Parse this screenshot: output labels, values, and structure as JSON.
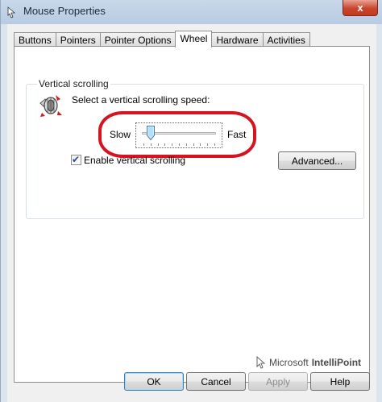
{
  "window": {
    "title": "Mouse Properties",
    "close_label": "x"
  },
  "tabs": [
    {
      "label": "Buttons"
    },
    {
      "label": "Pointers"
    },
    {
      "label": "Pointer Options"
    },
    {
      "label": "Wheel",
      "active": true
    },
    {
      "label": "Hardware"
    },
    {
      "label": "Activities"
    }
  ],
  "vertical_scrolling": {
    "group_label": "Vertical scrolling",
    "speed_prompt": "Select a vertical scrolling speed:",
    "slow_label": "Slow",
    "fast_label": "Fast",
    "speed_position": 0.12,
    "enable_checkbox_label": "Enable vertical scrolling",
    "enable_checked": true,
    "advanced_label": "Advanced..."
  },
  "brand": {
    "microsoft": "Microsoft",
    "product": "IntelliPoint"
  },
  "footer": {
    "ok_label": "OK",
    "cancel_label": "Cancel",
    "apply_label": "Apply",
    "help_label": "Help"
  },
  "colors": {
    "highlight_ellipse": "#d7131f",
    "default_button_border": "#3c7fb1"
  },
  "icons": {
    "title": "mouse-properties-icon",
    "group": "scroll-wheel-icon",
    "brand": "cursor-icon"
  }
}
